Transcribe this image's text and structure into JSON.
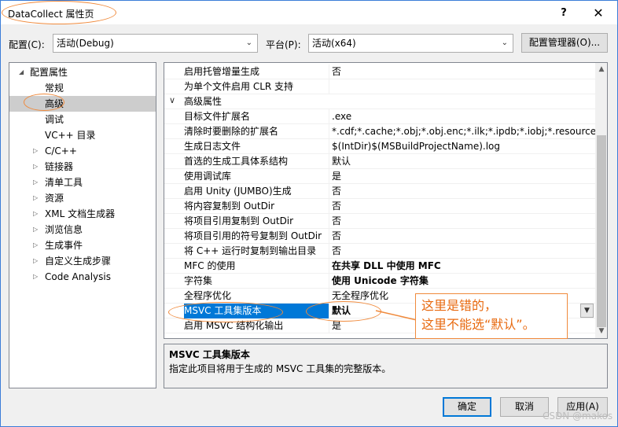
{
  "window": {
    "title": "DataCollect 属性页",
    "help": "?",
    "close": "✕"
  },
  "toolbar": {
    "config_label": "配置(C):",
    "config_value": "活动(Debug)",
    "platform_label": "平台(P):",
    "platform_value": "活动(x64)",
    "config_manager": "配置管理器(O)..."
  },
  "tree": {
    "root": "配置属性",
    "items": [
      {
        "label": "常规",
        "expandable": false
      },
      {
        "label": "高级",
        "expandable": false,
        "selected": true
      },
      {
        "label": "调试",
        "expandable": false
      },
      {
        "label": "VC++ 目录",
        "expandable": false
      },
      {
        "label": "C/C++",
        "expandable": true
      },
      {
        "label": "链接器",
        "expandable": true
      },
      {
        "label": "清单工具",
        "expandable": true
      },
      {
        "label": "资源",
        "expandable": true
      },
      {
        "label": "XML 文档生成器",
        "expandable": true
      },
      {
        "label": "浏览信息",
        "expandable": true
      },
      {
        "label": "生成事件",
        "expandable": true
      },
      {
        "label": "自定义生成步骤",
        "expandable": true
      },
      {
        "label": "Code Analysis",
        "expandable": true
      }
    ]
  },
  "grid": {
    "rows": [
      {
        "name": "启用托管增量生成",
        "value": "否"
      },
      {
        "name": "为单个文件启用 CLR 支持",
        "value": ""
      },
      {
        "name": "高级属性",
        "value": "",
        "category": true
      },
      {
        "name": "目标文件扩展名",
        "value": ".exe"
      },
      {
        "name": "清除时要删除的扩展名",
        "value": "*.cdf;*.cache;*.obj;*.obj.enc;*.ilk;*.ipdb;*.iobj;*.resources;*.tl"
      },
      {
        "name": "生成日志文件",
        "value": "$(IntDir)$(MSBuildProjectName).log"
      },
      {
        "name": "首选的生成工具体系结构",
        "value": "默认"
      },
      {
        "name": "使用调试库",
        "value": "是"
      },
      {
        "name": "启用 Unity (JUMBO)生成",
        "value": "否"
      },
      {
        "name": "将内容复制到 OutDir",
        "value": "否"
      },
      {
        "name": "将项目引用复制到 OutDir",
        "value": "否"
      },
      {
        "name": "将项目引用的符号复制到 OutDir",
        "value": "否"
      },
      {
        "name": "将 C++ 运行时复制到输出目录",
        "value": "否"
      },
      {
        "name": "MFC 的使用",
        "value": "在共享 DLL 中使用 MFC",
        "bold": true
      },
      {
        "name": "字符集",
        "value": "使用 Unicode 字符集",
        "bold": true
      },
      {
        "name": "全程序优化",
        "value": "无全程序优化"
      },
      {
        "name": "MSVC 工具集版本",
        "value": "默认",
        "bold": true,
        "selected": true
      },
      {
        "name": "启用 MSVC 结构化输出",
        "value": "是"
      }
    ]
  },
  "description": {
    "title": "MSVC 工具集版本",
    "text": "指定此项目将用于生成的 MSVC 工具集的完整版本。"
  },
  "annotation": {
    "line1": "这里是错的，",
    "line2": "这里不能选“默认”。"
  },
  "buttons": {
    "ok": "确定",
    "cancel": "取消",
    "apply": "应用(A)"
  },
  "watermark": "CSDN @makos",
  "colors": {
    "accent": "#0078d7",
    "annotation": "#f08a3c"
  }
}
